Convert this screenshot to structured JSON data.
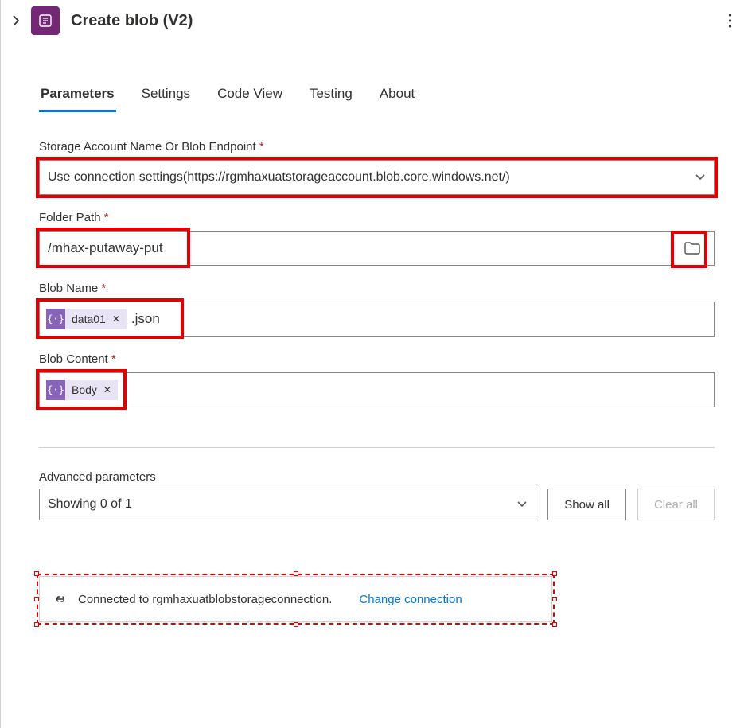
{
  "header": {
    "title": "Create blob (V2)"
  },
  "tabs": [
    {
      "label": "Parameters",
      "active": true
    },
    {
      "label": "Settings",
      "active": false
    },
    {
      "label": "Code View",
      "active": false
    },
    {
      "label": "Testing",
      "active": false
    },
    {
      "label": "About",
      "active": false
    }
  ],
  "fields": {
    "storage": {
      "label": "Storage Account Name Or Blob Endpoint",
      "required": "*",
      "value": "Use connection settings(https://rgmhaxuatstorageaccount.blob.core.windows.net/)"
    },
    "folder": {
      "label": "Folder Path",
      "required": "*",
      "value": "/mhax-putaway-put"
    },
    "blobname": {
      "label": "Blob Name",
      "required": "*",
      "token": "data01",
      "suffix": ".json"
    },
    "blobcontent": {
      "label": "Blob Content",
      "required": "*",
      "token": "Body"
    }
  },
  "advanced": {
    "label": "Advanced parameters",
    "showing": "Showing 0 of 1",
    "showAll": "Show all",
    "clearAll": "Clear all"
  },
  "connection": {
    "text": "Connected to rgmhaxuatblobstorageconnection.",
    "change": "Change connection"
  }
}
